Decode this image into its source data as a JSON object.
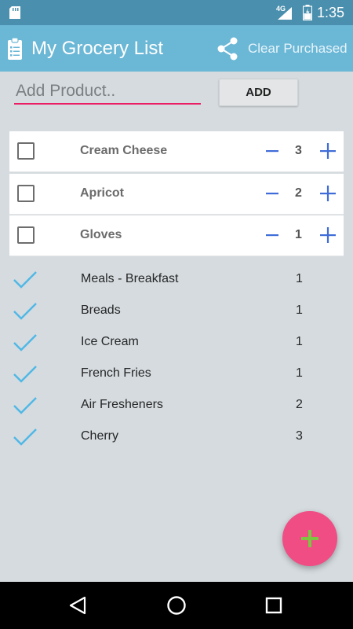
{
  "status_bar": {
    "network": "4G",
    "time": "1:35"
  },
  "app_bar": {
    "title": "My Grocery List",
    "clear_label": "Clear Purchased"
  },
  "add_row": {
    "placeholder": "Add Product..",
    "button_label": "ADD"
  },
  "active_items": [
    {
      "name": "Cream Cheese",
      "qty": "3"
    },
    {
      "name": "Apricot",
      "qty": "2"
    },
    {
      "name": "Gloves",
      "qty": "1"
    }
  ],
  "purchased_items": [
    {
      "name": "Meals - Breakfast",
      "qty": "1"
    },
    {
      "name": "Breads",
      "qty": "1"
    },
    {
      "name": "Ice Cream",
      "qty": "1"
    },
    {
      "name": "French Fries",
      "qty": "1"
    },
    {
      "name": "Air Fresheners",
      "qty": "2"
    },
    {
      "name": "Cherry",
      "qty": "3"
    }
  ],
  "icons": {
    "appbar": "clipboard-list-icon",
    "share": "share-icon",
    "minus": "minus-icon",
    "plus": "plus-icon",
    "check": "checkmark-icon",
    "fab": "plus-icon"
  },
  "colors": {
    "status_bar": "#4a8fad",
    "app_bar": "#6bb7d6",
    "background": "#d5dbdf",
    "accent": "#e91e63",
    "stepper": "#3f6cd8",
    "check": "#4fb8e6",
    "fab": "#f04d84",
    "fab_plus": "#7cc73f"
  }
}
